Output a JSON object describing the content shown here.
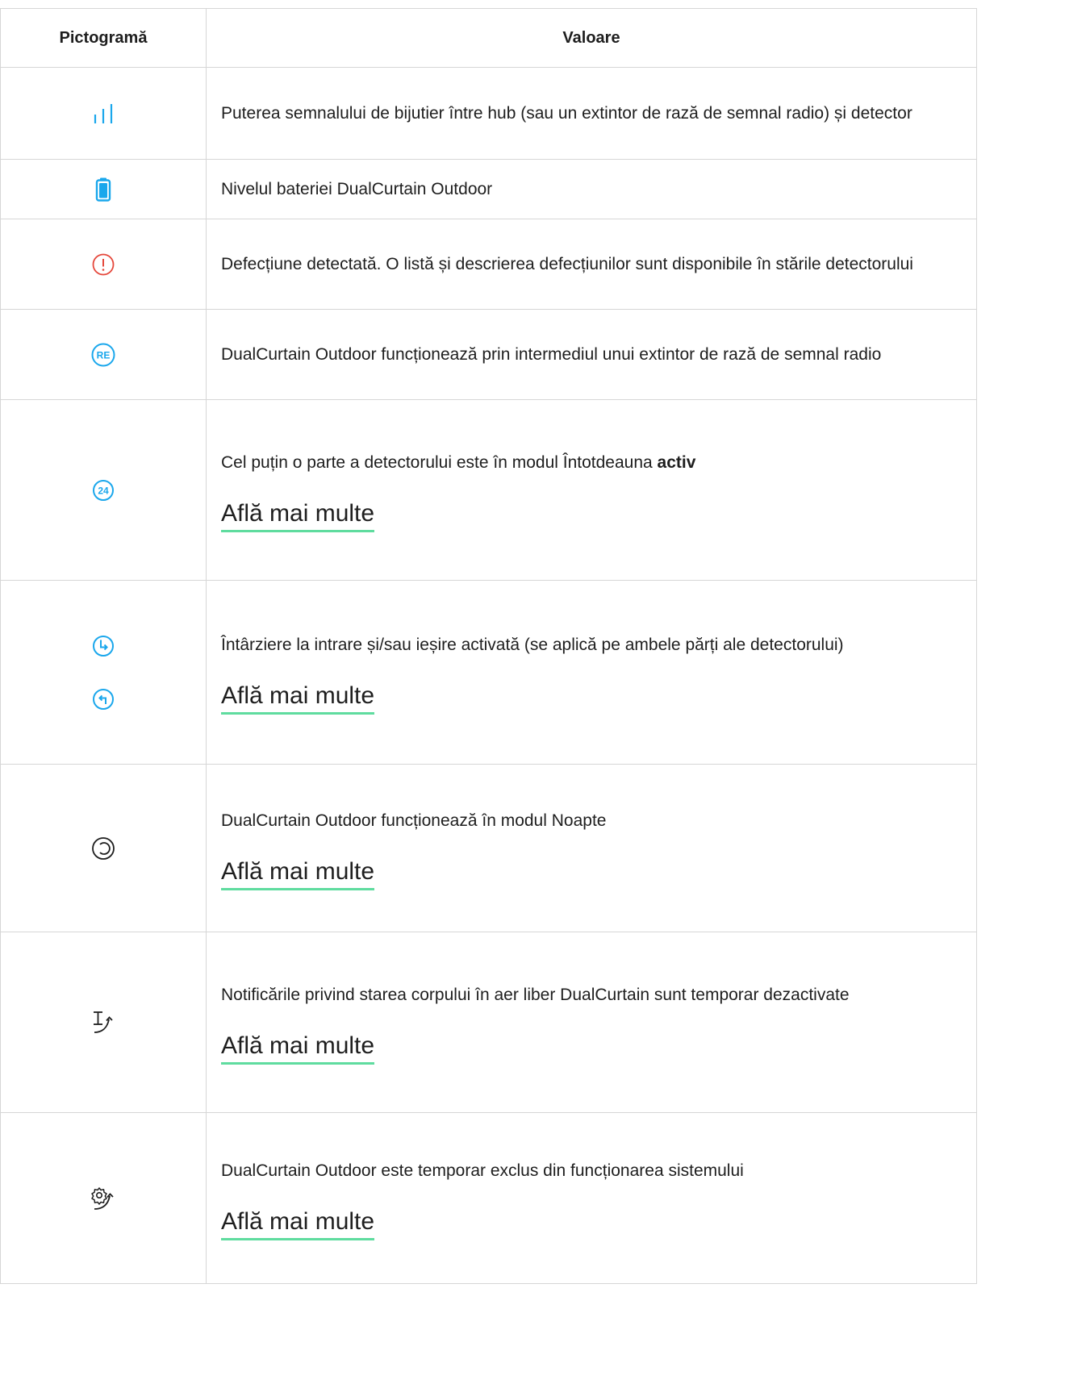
{
  "table": {
    "header": {
      "icon_col": "Pictogramă",
      "value_col": "Valoare"
    },
    "rows": [
      {
        "icon": "signal-strength-icon",
        "text": "Puterea semnalului de bijutier între hub (sau un extintor de rază de semnal radio) și detector"
      },
      {
        "icon": "battery-icon",
        "text": "Nivelul bateriei DualCurtain Outdoor"
      },
      {
        "icon": "malfunction-icon",
        "text": "Defecțiune detectată. O listă și descrierea defecțiunilor sunt disponibile în stările detectorului"
      },
      {
        "icon": "range-extender-icon",
        "text": "DualCurtain Outdoor funcționează prin intermediul unui extintor de rază de semnal radio"
      },
      {
        "icon": "always-active-icon",
        "text_before": "Cel puțin o parte a detectorului este în modul Întotdeauna ",
        "text_bold": "activ",
        "link": "Află mai multe"
      },
      {
        "icon": "entry-delay-icon",
        "icon2": "exit-delay-icon",
        "text": "Întârziere la intrare și/sau ieșire activată (se aplică pe ambele părți ale detectorului)",
        "link": "Află mai multe"
      },
      {
        "icon": "night-mode-icon",
        "text": "DualCurtain Outdoor funcționează în modul Noapte",
        "link": "Află mai multe"
      },
      {
        "icon": "lid-notifications-off-icon",
        "text": "Notificările privind starea corpului în aer liber DualCurtain sunt temporar dezactivate",
        "link": "Află mai multe"
      },
      {
        "icon": "device-deactivated-icon",
        "text": "DualCurtain Outdoor este temporar exclus din funcționarea sistemului",
        "link": "Află mai multe"
      }
    ]
  },
  "colors": {
    "accent": "#1aa7ec",
    "error": "#e5473b",
    "link_underline": "#5fdc9f",
    "border": "#d6d6d6",
    "text": "#1e1e1e"
  }
}
